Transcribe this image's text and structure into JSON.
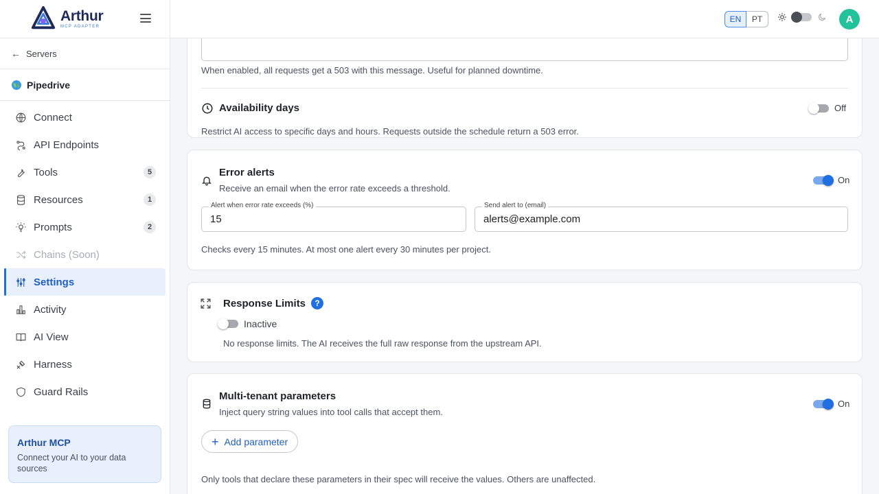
{
  "app": {
    "title": "Arthur",
    "subtitle": "MCP ADAPTER"
  },
  "sidebar": {
    "back_label": "Servers",
    "server_name": "Pipedrive",
    "items": [
      {
        "label": "Connect",
        "icon": "globe-icon"
      },
      {
        "label": "API Endpoints",
        "icon": "endpoint-icon"
      },
      {
        "label": "Tools",
        "icon": "wrench-icon",
        "badge": "5"
      },
      {
        "label": "Resources",
        "icon": "database-icon",
        "badge": "1"
      },
      {
        "label": "Prompts",
        "icon": "bulb-icon",
        "badge": "2"
      },
      {
        "label": "Chains (Soon)",
        "icon": "shuffle-icon",
        "disabled": true
      },
      {
        "label": "Settings",
        "icon": "sliders-icon",
        "active": true
      },
      {
        "label": "Activity",
        "icon": "bar-chart-icon"
      },
      {
        "label": "AI View",
        "icon": "book-icon"
      },
      {
        "label": "Harness",
        "icon": "harness-icon"
      },
      {
        "label": "Guard Rails",
        "icon": "shield-icon"
      }
    ],
    "promo": {
      "title": "Arthur MCP",
      "text": "Connect your AI to your data sources"
    }
  },
  "topbar": {
    "lang_en": "EN",
    "lang_pt": "PT",
    "avatar_initial": "A"
  },
  "maintenance": {
    "help": "When enabled, all requests get a 503 with this message. Useful for planned downtime."
  },
  "availability": {
    "title": "Availability days",
    "toggle_label": "Off",
    "toggle_on": false,
    "help": "Restrict AI access to specific days and hours. Requests outside the schedule return a 503 error."
  },
  "error_alerts": {
    "title": "Error alerts",
    "subtitle": "Receive an email when the error rate exceeds a threshold.",
    "toggle_label": "On",
    "toggle_on": true,
    "threshold_label": "Alert when error rate exceeds (%)",
    "threshold_value": "15",
    "email_label": "Send alert to (email)",
    "email_value": "alerts@example.com",
    "help": "Checks every 15 minutes. At most one alert every 30 minutes per project."
  },
  "response_limits": {
    "title": "Response Limits",
    "help_icon": "?",
    "toggle_label": "Inactive",
    "toggle_on": false,
    "help": "No response limits. The AI receives the full raw response from the upstream API."
  },
  "multi_tenant": {
    "title": "Multi-tenant parameters",
    "subtitle": "Inject query string values into tool calls that accept them.",
    "toggle_label": "On",
    "toggle_on": true,
    "add_label": "Add parameter",
    "help": "Only tools that declare these parameters in their spec will receive the values. Others are unaffected."
  },
  "colors": {
    "accent": "#1f6fe0",
    "avatar": "#22c39a",
    "active_bg": "#e8f0fc"
  }
}
